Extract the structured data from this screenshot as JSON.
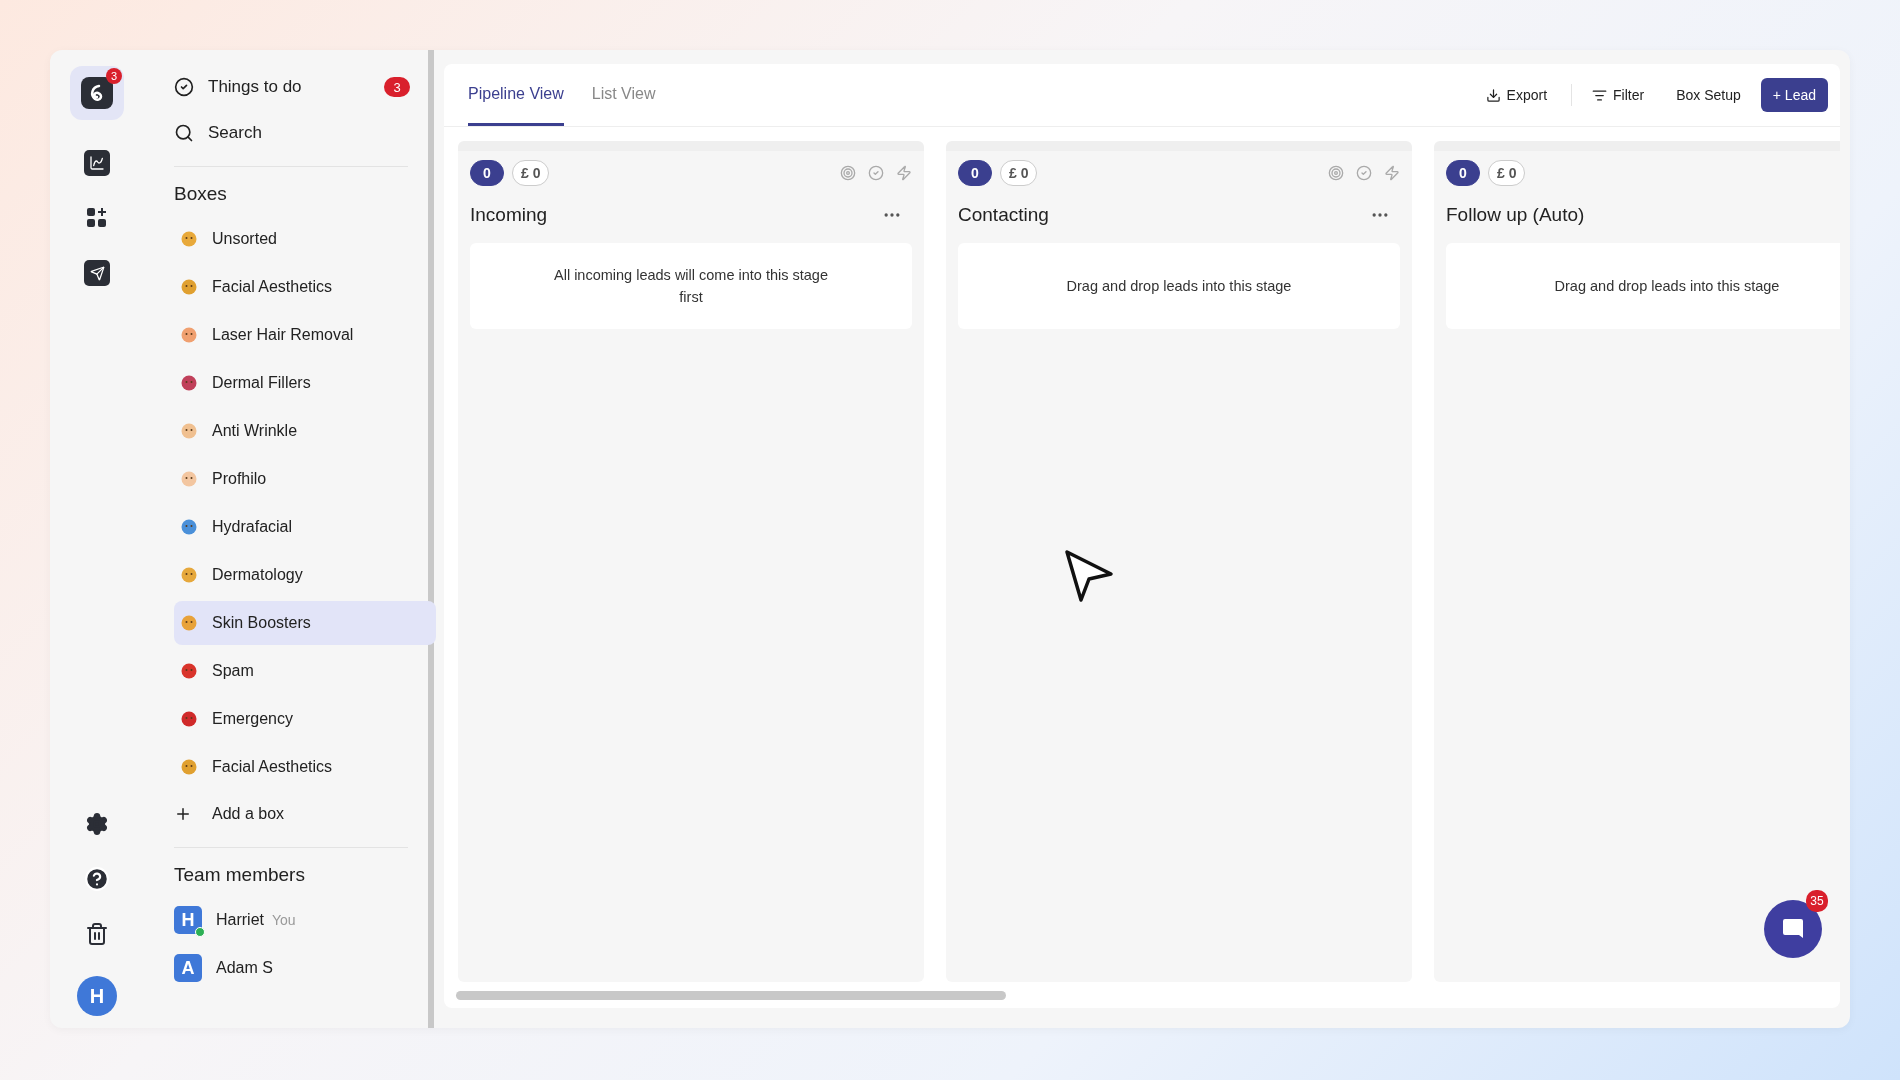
{
  "rail": {
    "logo_badge": "3",
    "avatar": "H"
  },
  "sidebar": {
    "things_to_do": {
      "label": "Things to do",
      "count": "3"
    },
    "search": {
      "label": "Search"
    },
    "boxes_title": "Boxes",
    "boxes": [
      {
        "label": "Unsorted",
        "color": "#e8a93a",
        "selected": false
      },
      {
        "label": "Facial Aesthetics",
        "color": "#e0a030",
        "selected": false
      },
      {
        "label": "Laser Hair Removal",
        "color": "#f0a070",
        "selected": false
      },
      {
        "label": "Dermal Fillers",
        "color": "#c0405a",
        "selected": false
      },
      {
        "label": "Anti Wrinkle",
        "color": "#f0c090",
        "selected": false
      },
      {
        "label": "Profhilo",
        "color": "#f3c6a0",
        "selected": false
      },
      {
        "label": "Hydrafacial",
        "color": "#4a90d9",
        "selected": false
      },
      {
        "label": "Dermatology",
        "color": "#e6a83c",
        "selected": false
      },
      {
        "label": "Skin Boosters",
        "color": "#e8a23a",
        "selected": true
      },
      {
        "label": "Spam",
        "color": "#d9342b",
        "selected": false
      },
      {
        "label": "Emergency",
        "color": "#d02a2a",
        "selected": false
      },
      {
        "label": "Facial Aesthetics",
        "color": "#e0a030",
        "selected": false
      }
    ],
    "add_box": "Add a box",
    "team_title": "Team members",
    "members": [
      {
        "initial": "H",
        "name": "Harriet",
        "tag": "You",
        "online": true
      },
      {
        "initial": "A",
        "name": "Adam S",
        "online": false
      }
    ]
  },
  "tabs": [
    {
      "label": "Pipeline View",
      "selected": true
    },
    {
      "label": "List View",
      "selected": false
    }
  ],
  "toolbar": {
    "export": "Export",
    "filter": "Filter",
    "setup": "Box Setup",
    "lead": "+ Lead"
  },
  "columns": [
    {
      "kind": "manual",
      "count": "0",
      "value": "£ 0",
      "title": "Incoming",
      "hint": "All incoming leads will come into this stage first"
    },
    {
      "kind": "manual",
      "count": "0",
      "value": "£ 0",
      "title": "Contacting",
      "hint": "Drag and drop leads into this stage"
    },
    {
      "kind": "auto",
      "count": "0",
      "value": "£ 0",
      "title": "Follow up (Auto)",
      "hint": "Drag and drop leads into this stage"
    }
  ],
  "chat": {
    "badge": "35"
  }
}
